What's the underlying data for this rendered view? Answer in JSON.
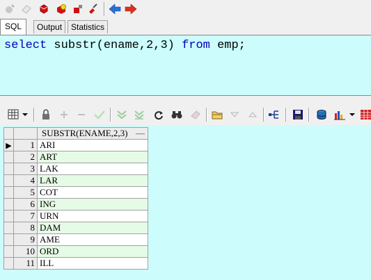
{
  "top_toolbar": {
    "icons": [
      "new-icon",
      "eraser-icon",
      "execute-icon",
      "open-icon",
      "pin-icon",
      "wrench-icon",
      "back-arrow-icon",
      "forward-arrow-icon"
    ]
  },
  "tabs": [
    {
      "label": "SQL",
      "active": true
    },
    {
      "label": "Output",
      "active": false
    },
    {
      "label": "Statistics",
      "active": false
    }
  ],
  "editor": {
    "sql": {
      "select": "select",
      "substr": "substr(ename,2,3)",
      "from": "from",
      "emp": "emp;"
    },
    "background": "#ccfcfc",
    "keyword_color": "#0000c0"
  },
  "grid_toolbar": {
    "icons": [
      "grid-icon",
      "dropdown-icon",
      "lock-icon",
      "add-icon",
      "minus-icon",
      "check-icon",
      "down-double-icon",
      "down-double-icon-2",
      "refresh-icon",
      "binoculars-icon",
      "eraser-icon",
      "folder-icon",
      "triangle-down-icon",
      "triangle-up-icon",
      "tree-icon",
      "save-icon",
      "database-icon",
      "chart-icon",
      "dropdown-icon",
      "table-icon"
    ]
  },
  "result": {
    "column_header": "SUBSTR(ENAME,2,3)",
    "sort_marker": "—",
    "rows": [
      {
        "num": "1",
        "value": "ARI"
      },
      {
        "num": "2",
        "value": "ART"
      },
      {
        "num": "3",
        "value": "LAK"
      },
      {
        "num": "4",
        "value": "LAR"
      },
      {
        "num": "5",
        "value": "COT"
      },
      {
        "num": "6",
        "value": "ING"
      },
      {
        "num": "7",
        "value": "URN"
      },
      {
        "num": "8",
        "value": "DAM"
      },
      {
        "num": "9",
        "value": "AME"
      },
      {
        "num": "10",
        "value": "ORD"
      },
      {
        "num": "11",
        "value": "ILL"
      }
    ],
    "current_row_indicator": "▶"
  }
}
